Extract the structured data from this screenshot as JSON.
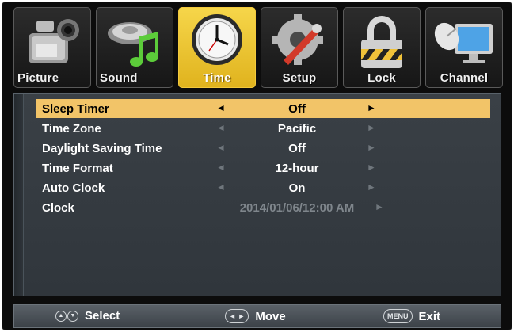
{
  "tabs": [
    {
      "label": "Picture",
      "icon": "camera-icon",
      "active": false
    },
    {
      "label": "Sound",
      "icon": "music-note-icon",
      "active": false
    },
    {
      "label": "Time",
      "icon": "clock-icon",
      "active": true
    },
    {
      "label": "Setup",
      "icon": "gear-wrench-icon",
      "active": false
    },
    {
      "label": "Lock",
      "icon": "padlock-icon",
      "active": false
    },
    {
      "label": "Channel",
      "icon": "satellite-dish-icon",
      "active": false
    }
  ],
  "rows": [
    {
      "label": "Sleep Timer",
      "value": "Off",
      "selected": true
    },
    {
      "label": "Time Zone",
      "value": "Pacific"
    },
    {
      "label": "Daylight Saving Time",
      "value": "Off"
    },
    {
      "label": "Time Format",
      "value": "12-hour"
    },
    {
      "label": "Auto Clock",
      "value": "On"
    },
    {
      "label": "Clock",
      "value": "2014/01/06/12:00 AM",
      "dimmed": true
    }
  ],
  "arrows": {
    "left": "◄",
    "right": "►"
  },
  "footer": {
    "select_label": "Select",
    "move_label": "Move",
    "exit_label": "Exit",
    "menu_key": "MENU"
  },
  "colors": {
    "highlight": "#f2c468",
    "active_tab": "#f0c53a",
    "panel_bg": "#353b41"
  }
}
